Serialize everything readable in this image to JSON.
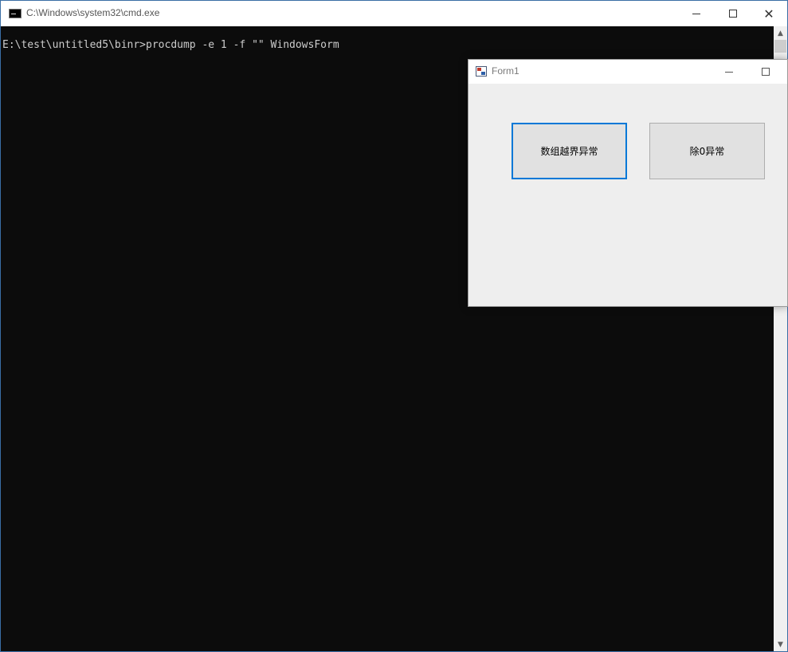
{
  "cmd": {
    "title": "C:\\Windows\\system32\\cmd.exe",
    "console_line": "E:\\test\\untitled5\\binr>procdump -e 1 -f \"\" WindowsForm",
    "scroll_up": "▲",
    "scroll_down": "▼",
    "close_glyph": "✕"
  },
  "form": {
    "title": "Form1",
    "buttons": {
      "array_out_of_bounds": "数组越界异常",
      "divide_by_zero": "除0异常"
    }
  },
  "icons": {
    "cmd": "console-icon",
    "form": "winform-icon"
  },
  "colors": {
    "console_bg": "#0c0c0c",
    "console_text": "#cccccc",
    "focus_border": "#0078d7",
    "form_bg": "#eeeeee"
  }
}
